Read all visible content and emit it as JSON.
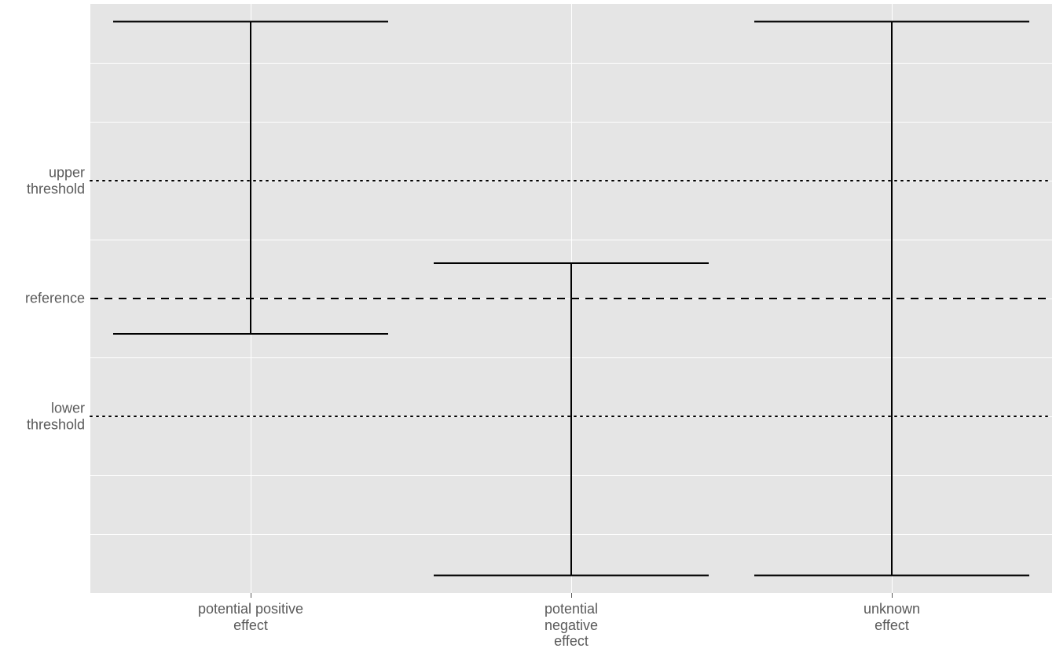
{
  "chart_data": {
    "type": "other",
    "description": "Error-bar / interval plot with three categorical groups and three horizontal reference lines (lower threshold, reference, upper threshold).",
    "y_axis": {
      "range": [
        0,
        10
      ],
      "gridlines": [
        1,
        2,
        3,
        4,
        5,
        6,
        7,
        8,
        9
      ],
      "labeled_positions": {
        "lower_threshold": 3,
        "reference": 5,
        "upper_threshold": 7
      }
    },
    "reference_lines": [
      {
        "id": "upper_threshold",
        "y": 7,
        "style": "dotted",
        "label_lines": [
          "upper",
          "threshold"
        ]
      },
      {
        "id": "reference",
        "y": 5,
        "style": "dashed",
        "label_lines": [
          "reference"
        ]
      },
      {
        "id": "lower_threshold",
        "y": 3,
        "style": "dotted",
        "label_lines": [
          "lower",
          "threshold"
        ]
      }
    ],
    "categories": [
      {
        "id": "positive",
        "label_lines": [
          "potential positive",
          "effect"
        ],
        "low": 4.4,
        "high": 9.7
      },
      {
        "id": "negative",
        "label_lines": [
          "potential",
          "negative",
          "effect"
        ],
        "low": 0.3,
        "high": 5.6
      },
      {
        "id": "unknown",
        "label_lines": [
          "unknown",
          "effect"
        ],
        "low": 0.3,
        "high": 9.7
      }
    ],
    "stroke_color": "#000000",
    "stroke_width": 2
  },
  "y_labels": {
    "upper_threshold_l1": "upper",
    "upper_threshold_l2": "threshold",
    "reference_l1": "reference",
    "lower_threshold_l1": "lower",
    "lower_threshold_l2": "threshold"
  },
  "x_labels": {
    "positive_l1": "potential positive",
    "positive_l2": "effect",
    "negative_l1": "potential",
    "negative_l2": "negative",
    "negative_l3": "effect",
    "unknown_l1": "unknown",
    "unknown_l2": "effect"
  }
}
